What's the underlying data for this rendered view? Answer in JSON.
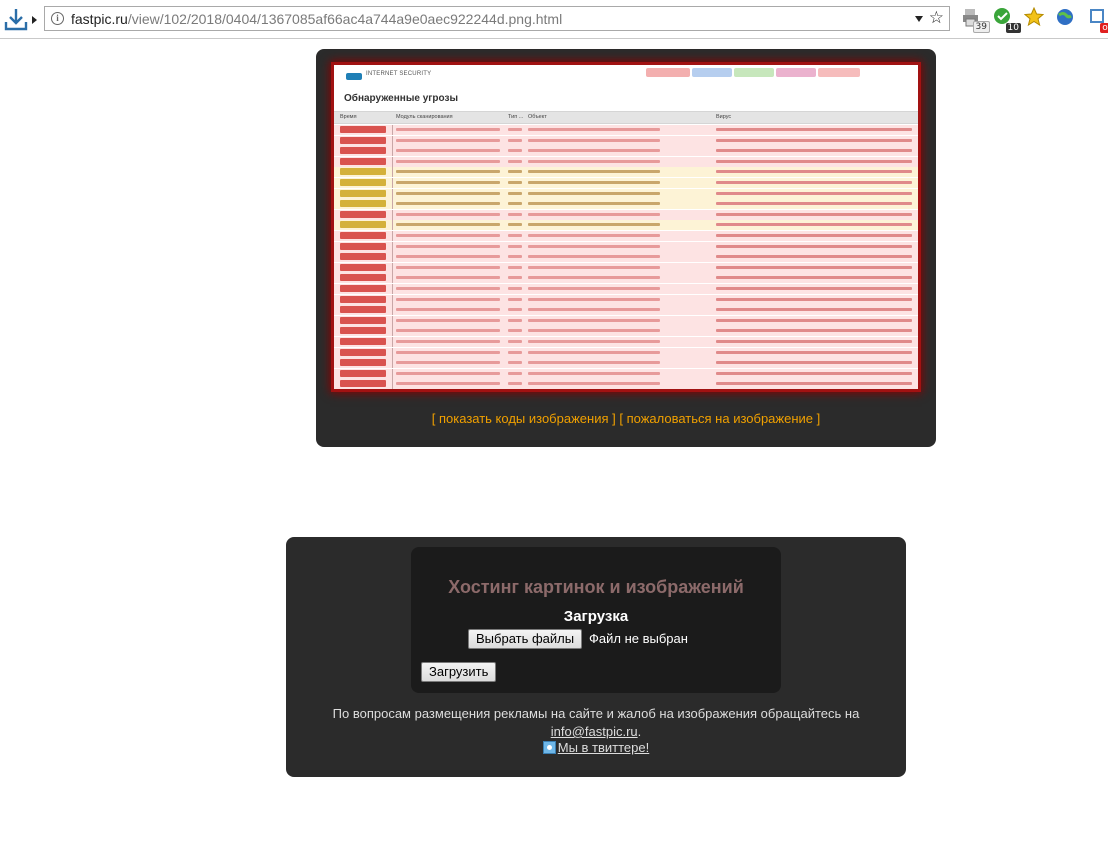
{
  "browser": {
    "url_host": "fastpic.ru",
    "url_path": "/view/102/2018/0404/1367085af66ac4a744a9e0aec922244d.png.html",
    "info_glyph": "i",
    "star_glyph": "☆",
    "extensions": [
      {
        "name": "printer-icon",
        "badge": "39"
      },
      {
        "name": "shield-check-icon",
        "badge": "10"
      },
      {
        "name": "star-icon",
        "badge": ""
      },
      {
        "name": "globe-icon",
        "badge": ""
      },
      {
        "name": "proxy-icon",
        "badge": "off"
      }
    ]
  },
  "screenshot_image": {
    "brand": "INTERNET SECURITY",
    "heading": "Обнаруженные угрозы",
    "columns": [
      "Время",
      "Модуль сканирования",
      "Тип ...",
      "Объект",
      "Вирус"
    ],
    "row_status": [
      "red",
      "red",
      "red",
      "red",
      "yellow",
      "yellow",
      "yellow",
      "yellow",
      "red",
      "yellow",
      "red",
      "red",
      "red",
      "red",
      "red",
      "red",
      "red",
      "red",
      "red",
      "red",
      "red",
      "red",
      "red",
      "red",
      "red",
      "red",
      "red",
      "red",
      "red",
      "red",
      "red"
    ],
    "colors": {
      "red": "#d9534f",
      "yellow": "#d4b13a",
      "red_row": "#fde3e3",
      "yellow_row": "#fdf3d6",
      "tab_colors": [
        "#f1a1a1",
        "#a9c5ec",
        "#bde3b0",
        "#e7a5c6",
        "#f4b0b0"
      ]
    }
  },
  "viewer_links": {
    "show_codes": "[ показать коды изображения ]",
    "report": "[ пожаловаться на изображение ]"
  },
  "upload": {
    "site_title": "Хостинг картинок и изображений",
    "heading": "Загрузка",
    "choose_files_button": "Выбрать файлы",
    "no_file_text": "Файл не выбран",
    "submit_button": "Загрузить"
  },
  "footer": {
    "contact_text": "По вопросам размещения рекламы на сайте и жалоб на изображения обращайтесь на",
    "email": "info@fastpic.ru",
    "email_suffix": ".",
    "twitter_link": "Мы в твиттере!"
  }
}
